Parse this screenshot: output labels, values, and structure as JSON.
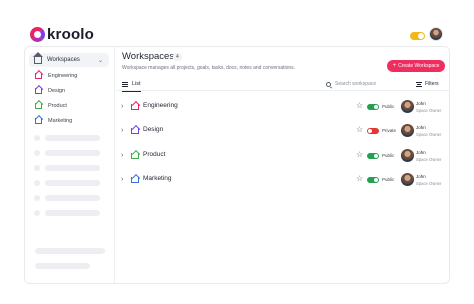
{
  "brand": {
    "name": "kroolo"
  },
  "sidebar": {
    "header": "Workspaces",
    "items": [
      {
        "label": "Engineering",
        "color": "#e8236a"
      },
      {
        "label": "Design",
        "color": "#7b3fe4"
      },
      {
        "label": "Product",
        "color": "#3fae49"
      },
      {
        "label": "Marketing",
        "color": "#3b6fe0"
      }
    ]
  },
  "main": {
    "title": "Workspaces",
    "count": "4",
    "subtitle": "Workspace manages all projects, goals, tasks, docs, notes and conversations.",
    "create_label": "Create Workspace",
    "tab_list": "List",
    "search_placeholder": "Search workspace",
    "filters_label": "Filters",
    "rows": [
      {
        "name": "Engineering",
        "visibility": "Public",
        "toggle": "on",
        "color": "#e8236a",
        "owner": "John",
        "role": "Space Owner"
      },
      {
        "name": "Design",
        "visibility": "Private",
        "toggle": "off",
        "color": "#7b3fe4",
        "owner": "John",
        "role": "Space Owner"
      },
      {
        "name": "Product",
        "visibility": "Public",
        "toggle": "on",
        "color": "#3fae49",
        "owner": "John",
        "role": "Space Owner"
      },
      {
        "name": "Marketing",
        "visibility": "Public",
        "toggle": "on",
        "color": "#3b6fe0",
        "owner": "John",
        "role": "Space Owner"
      }
    ]
  },
  "colors": {
    "accent": "#ef2d5e",
    "toggle_on": "#22a150",
    "toggle_off": "#e53636",
    "theme_toggle": "#f3b71c"
  }
}
